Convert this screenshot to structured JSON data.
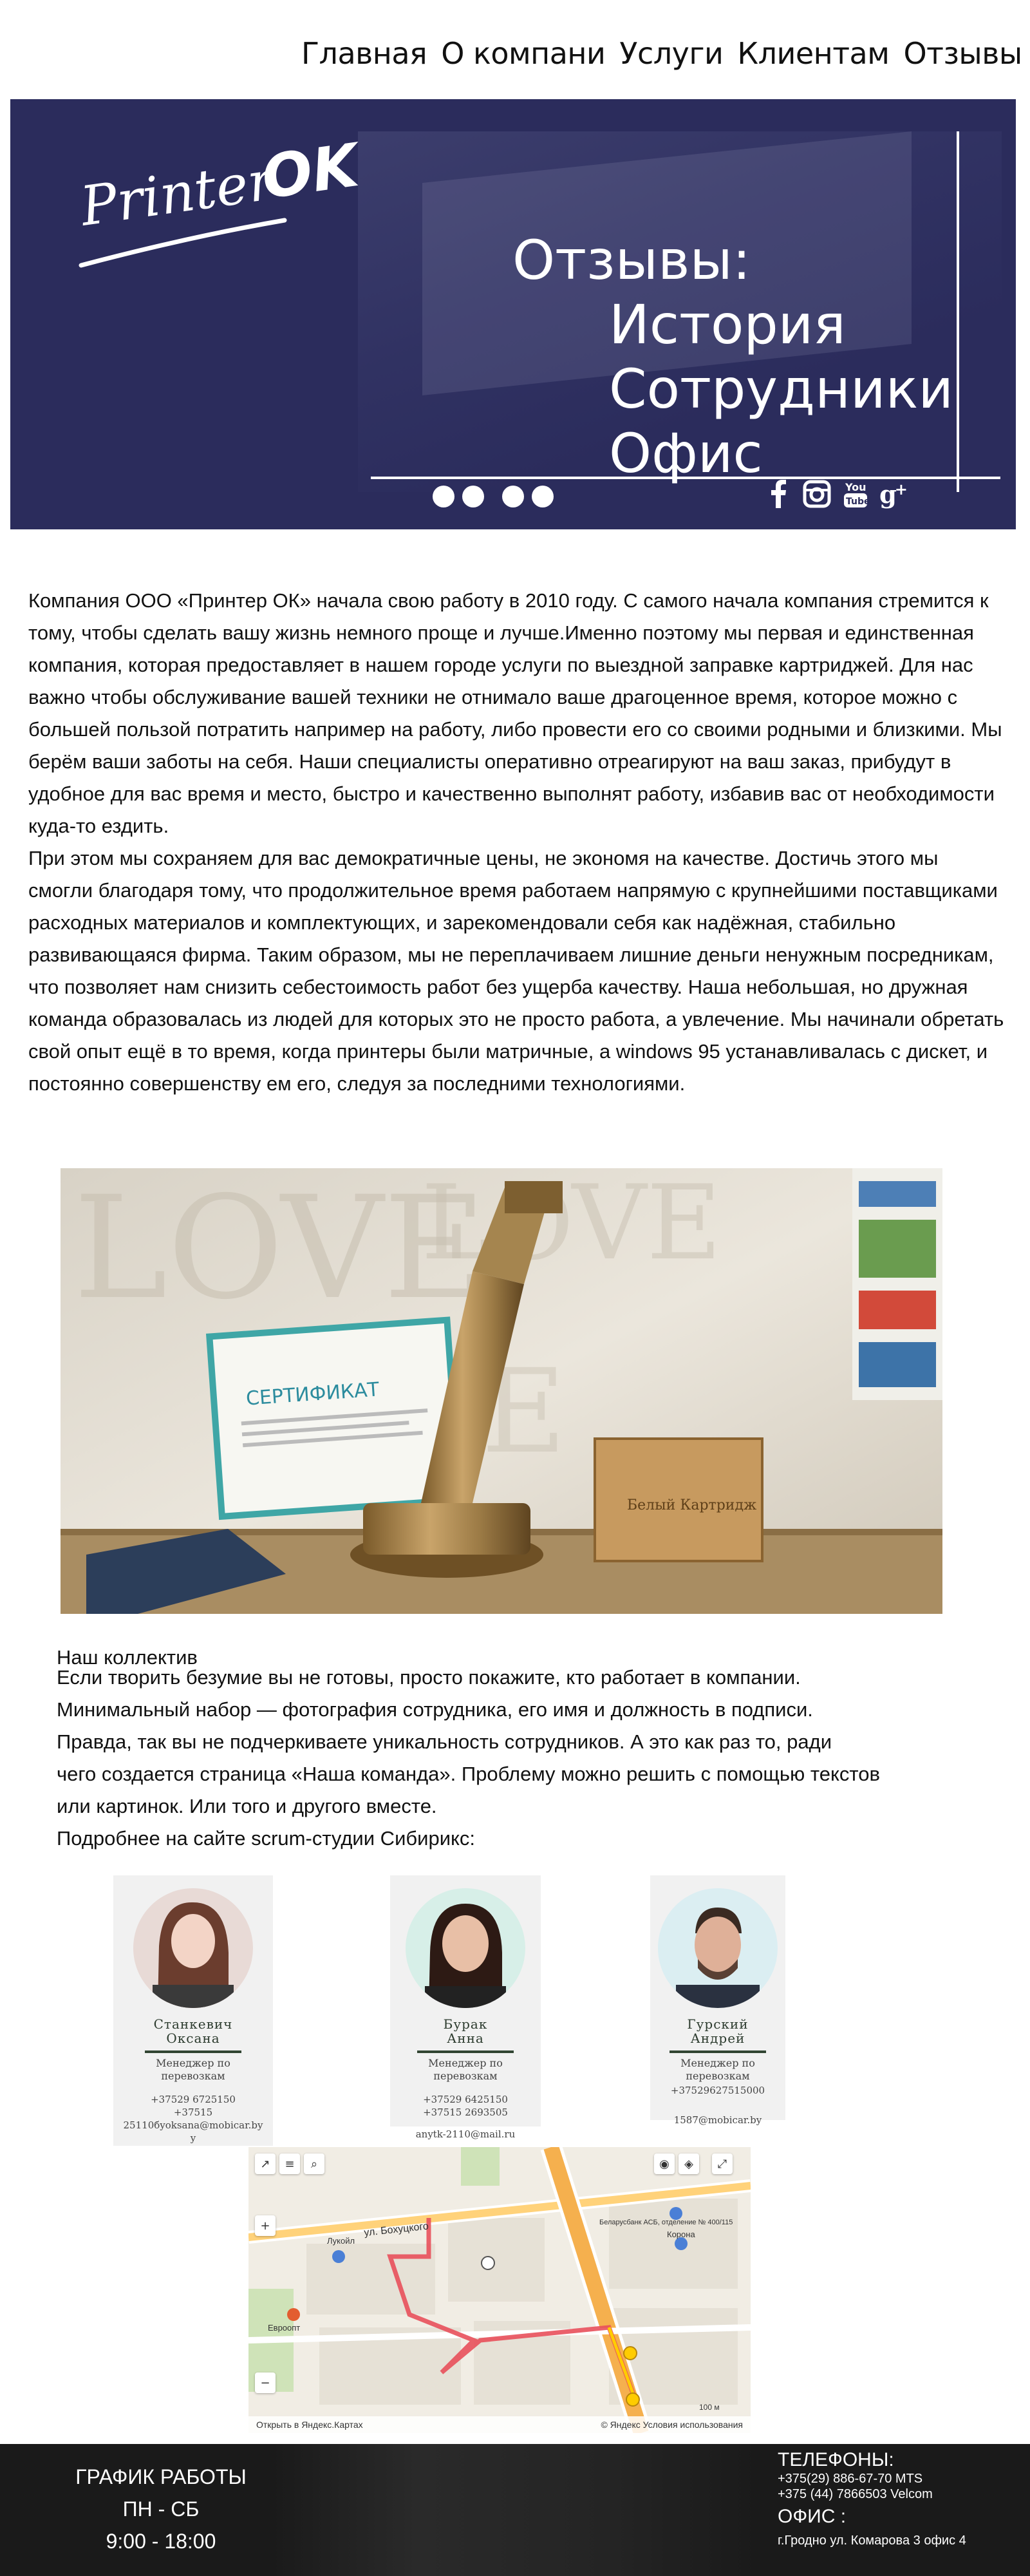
{
  "nav": {
    "items": [
      {
        "label": "Главная"
      },
      {
        "label": "О компани"
      },
      {
        "label": "Услуги"
      },
      {
        "label": "Клиентам"
      },
      {
        "label": "Отзывы"
      }
    ]
  },
  "hero": {
    "logo_text": "Printer",
    "logo_ok": "OK",
    "title_line1": "Отзывы:",
    "title_line2": "История",
    "title_line3": "Сотрудники",
    "title_line4": "Офис",
    "slide_count": 4,
    "socials": [
      {
        "icon": "facebook-icon"
      },
      {
        "icon": "instagram-icon"
      },
      {
        "icon": "youtube-icon"
      },
      {
        "icon": "google-plus-icon"
      }
    ]
  },
  "about": {
    "paragraph1": "Компания ООО «Принтер ОК» начала свою работу в 2010 году. С самого начала компания стремится к тому, чтобы сделать вашу жизнь немного проще и лучше.Именно поэтому мы первая и единственная компания, которая предоставляет в нашем городе услуги по выездной  заправке картриджей. Для нас важно чтобы обслуживание вашей техники не отнимало ваше драгоценное время, которое можно с большей пользой потратить например на работу, либо провести его со своими родными и близкими.  Мы берём ваши заботы на себя. Наши специалисты оперативно отреагируют на ваш заказ, прибудут в удобное для вас время и место, быстро и качественно выполнят работу, избавив вас от необходимости куда-то ездить.",
    "paragraph2": "При этом мы сохраняем для вас демократичные цены, не экономя на качестве. Достичь этого мы смогли благодаря тому, что продолжительное время работаем напрямую с крупнейшими поставщиками расходных материалов и комплектующих, и зарекомендовали себя как надёжная, стабильно развивающаяся фирма. Таким образом, мы не переплачиваем лишние деньги ненужным посредникам, что позволяет нам снизить себестоимость работ без ущерба качеству. Наша небольшая, но дружная команда образовалась из людей для которых это не просто работа, а увлечение. Мы начинали обретать свой опыт ещё в то время, когда принтеры были матричные, а windows 95 устанавливалась с дискет, и постоянно совершенству ем его, следуя за последними технологиями."
  },
  "photo": {
    "certificate_title": "СЕРТИФИКАТ",
    "brand_label": "Белый Картридж"
  },
  "team": {
    "heading": "Наш коллектив",
    "lines": [
      "Если творить безумие вы не готовы, просто покажите, кто работает в компании.",
      "Минимальный набор — фотография сотрудника, его имя и должность в подписи.",
      "Правда, так вы не подчеркиваете уникальность сотрудников. А это как раз то, ради",
      "чего создается страница «Наша команда». Проблему можно решить с помощью текстов",
      "или картинок. Или того и другого вместе.",
      "Подробнее на сайте scrum-студии Сибирикс:"
    ],
    "members": [
      {
        "name1": "Станкевич",
        "name2": "Оксана",
        "role1": "Менеджер по",
        "role2": "перевозкам",
        "phone1": "+37529 6725150",
        "phone2": "+37515",
        "email": "25110бyoksana@mobicar.byy"
      },
      {
        "name1": "Бурак",
        "name2": "Анна",
        "role1": "Менеджер по",
        "role2": "перевозкам",
        "phone1": "+37529 6425150",
        "phone2": "+37515 2693505",
        "email": "anytk-2110@mail.ru"
      },
      {
        "name1": "Гурский",
        "name2": "Андрей",
        "role1": "Менеджер по",
        "role2": "перевозкам",
        "phone1": "+37529627515000",
        "phone2": "",
        "email": "1587@mobicar.by"
      }
    ]
  },
  "map": {
    "street_label": "ул. Бохуцкого",
    "place1": "Лукойл",
    "place2": "Беларусбанк АСБ, отделение № 400/115",
    "place3": "Корона",
    "place4": "Евроопт",
    "scale": "100 м",
    "open_link": "Открыть в Яндекс.Картах",
    "copyright": "© Яндекс Условия использования"
  },
  "footer": {
    "schedule_title": "ГРАФИК РАБОТЫ",
    "days": "ПН - СБ",
    "hours": "9:00 - 18:00",
    "phones_title": "ТЕЛЕФОНЫ:",
    "phone1": "+375(29) 886-67-70 MTS",
    "phone2": "+375 (44) 7866503  Velcom",
    "office_title": "ОФИС :",
    "address": "г.Гродно ул. Комарова 3 офис 4"
  },
  "colors": {
    "hero_bg": "#2b2c5c",
    "footer_bg": "#1a1a1a",
    "route": "#e8505b"
  }
}
